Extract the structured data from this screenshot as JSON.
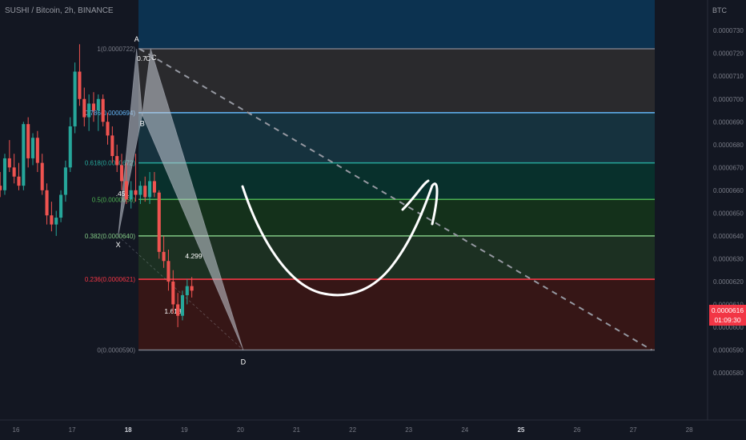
{
  "header": {
    "title": "SUSHI / Bitcoin, 2h, BINANCE",
    "currency": "BTC"
  },
  "price_tag": {
    "price": "0.0000616",
    "countdown": "01:09:30",
    "color": "#f23645"
  },
  "chart_data": {
    "type": "candlestick",
    "y_unit": "BTC",
    "ylim": [
      5.74e-05,
      7.37e-05
    ],
    "y_ticks": [
      "0.0000730",
      "0.0000720",
      "0.0000710",
      "0.0000700",
      "0.0000690",
      "0.0000680",
      "0.0000670",
      "0.0000660",
      "0.0000650",
      "0.0000640",
      "0.0000630",
      "0.0000620",
      "0.0000610",
      "0.0000600",
      "0.0000590",
      "0.0000580"
    ],
    "x_ticks": [
      "16",
      "17",
      "18",
      "19",
      "20",
      "21",
      "22",
      "23",
      "24",
      "25",
      "26",
      "27",
      "28"
    ],
    "x_tick_emphasis": [
      "18",
      "25"
    ],
    "fib_levels": [
      {
        "ratio": "1",
        "value": 7.22e-05,
        "label": "1(0.0000722)",
        "color": "#787b86",
        "fill": "#0c3250"
      },
      {
        "ratio": "0.786",
        "value": 6.94e-05,
        "label": "0.786(0.0000694)",
        "color": "#64b5f6",
        "fill": "#2a2a2d"
      },
      {
        "ratio": "0.618",
        "value": 6.72e-05,
        "label": "0.618(0.0000672)",
        "color": "#26a69a",
        "fill": "#16323e"
      },
      {
        "ratio": "0.5",
        "value": 6.56e-05,
        "label": "0.5(0.0000656)",
        "color": "#4caf50",
        "fill": "#08302c"
      },
      {
        "ratio": "0.382",
        "value": 6.4e-05,
        "label": "0.382(0.0000640)",
        "color": "#81c784",
        "fill": "#14311b"
      },
      {
        "ratio": "0.236",
        "value": 6.21e-05,
        "label": "0.236(0.0000621)",
        "color": "#f23645",
        "fill": "#1c3022"
      },
      {
        "ratio": "0",
        "value": 5.9e-05,
        "label": "0(0.0000590)",
        "color": "#787b86",
        "fill": "#361616"
      }
    ],
    "harmonic_points": [
      {
        "name": "X",
        "day": 17.82,
        "price": 6.4e-05
      },
      {
        "name": "A",
        "day": 18.15,
        "price": 7.22e-05
      },
      {
        "name": "B",
        "day": 18.25,
        "price": 6.93e-05
      },
      {
        "name": "C",
        "day": 18.4,
        "price": 7.22e-05
      },
      {
        "name": "D",
        "day": 20.05,
        "price": 5.9e-05
      }
    ],
    "ratio_labels": [
      "0.7",
      "C",
      ".451",
      "4.299",
      "1.618"
    ],
    "candles": [
      {
        "o": 6.68e-05,
        "h": 6.76e-05,
        "l": 6.58e-05,
        "c": 6.62e-05
      },
      {
        "o": 6.62e-05,
        "h": 6.77e-05,
        "l": 6.57e-05,
        "c": 6.72e-05
      },
      {
        "o": 6.72e-05,
        "h": 6.82e-05,
        "l": 6.64e-05,
        "c": 6.65e-05
      },
      {
        "o": 6.65e-05,
        "h": 6.71e-05,
        "l": 6.57e-05,
        "c": 6.6e-05
      },
      {
        "o": 6.6e-05,
        "h": 6.68e-05,
        "l": 6.54e-05,
        "c": 6.64e-05
      },
      {
        "o": 6.64e-05,
        "h": 6.7e-05,
        "l": 6.56e-05,
        "c": 6.58e-05
      },
      {
        "o": 6.58e-05,
        "h": 6.66e-05,
        "l": 6.52e-05,
        "c": 6.56e-05
      },
      {
        "o": 6.56e-05,
        "h": 6.63e-05,
        "l": 6.54e-05,
        "c": 6.62e-05
      },
      {
        "o": 6.62e-05,
        "h": 6.68e-05,
        "l": 6.57e-05,
        "c": 6.6e-05
      },
      {
        "o": 6.6e-05,
        "h": 6.76e-05,
        "l": 6.58e-05,
        "c": 6.74e-05
      },
      {
        "o": 6.74e-05,
        "h": 6.82e-05,
        "l": 6.68e-05,
        "c": 6.7e-05
      },
      {
        "o": 6.7e-05,
        "h": 6.76e-05,
        "l": 6.63e-05,
        "c": 6.66e-05
      },
      {
        "o": 6.66e-05,
        "h": 6.72e-05,
        "l": 6.6e-05,
        "c": 6.62e-05
      },
      {
        "o": 6.62e-05,
        "h": 6.9e-05,
        "l": 6.6e-05,
        "c": 6.89e-05
      },
      {
        "o": 6.89e-05,
        "h": 6.92e-05,
        "l": 6.7e-05,
        "c": 6.74e-05
      },
      {
        "o": 6.74e-05,
        "h": 6.85e-05,
        "l": 6.71e-05,
        "c": 6.83e-05
      },
      {
        "o": 6.83e-05,
        "h": 6.86e-05,
        "l": 6.68e-05,
        "c": 6.72e-05
      },
      {
        "o": 6.72e-05,
        "h": 6.76e-05,
        "l": 6.58e-05,
        "c": 6.6e-05
      },
      {
        "o": 6.6e-05,
        "h": 6.63e-05,
        "l": 6.45e-05,
        "c": 6.49e-05
      },
      {
        "o": 6.49e-05,
        "h": 6.55e-05,
        "l": 6.42e-05,
        "c": 6.45e-05
      },
      {
        "o": 6.45e-05,
        "h": 6.51e-05,
        "l": 6.4e-05,
        "c": 6.48e-05
      },
      {
        "o": 6.48e-05,
        "h": 6.6e-05,
        "l": 6.46e-05,
        "c": 6.58e-05
      },
      {
        "o": 6.58e-05,
        "h": 6.73e-05,
        "l": 6.55e-05,
        "c": 6.7e-05
      },
      {
        "o": 6.7e-05,
        "h": 6.92e-05,
        "l": 6.68e-05,
        "c": 6.88e-05
      },
      {
        "o": 6.88e-05,
        "h": 7.16e-05,
        "l": 6.85e-05,
        "c": 7.12e-05
      },
      {
        "o": 7.12e-05,
        "h": 7.24e-05,
        "l": 6.97e-05,
        "c": 7e-05
      },
      {
        "o": 7e-05,
        "h": 7.05e-05,
        "l": 6.88e-05,
        "c": 6.92e-05
      },
      {
        "o": 6.92e-05,
        "h": 7.02e-05,
        "l": 6.86e-05,
        "c": 6.98e-05
      },
      {
        "o": 6.98e-05,
        "h": 7.03e-05,
        "l": 6.9e-05,
        "c": 6.95e-05
      },
      {
        "o": 6.95e-05,
        "h": 7.02e-05,
        "l": 6.86e-05,
        "c": 7e-05
      },
      {
        "o": 7e-05,
        "h": 7.02e-05,
        "l": 6.88e-05,
        "c": 6.9e-05
      },
      {
        "o": 6.9e-05,
        "h": 6.94e-05,
        "l": 6.8e-05,
        "c": 6.84e-05
      },
      {
        "o": 6.84e-05,
        "h": 6.88e-05,
        "l": 6.72e-05,
        "c": 6.75e-05
      },
      {
        "o": 6.75e-05,
        "h": 6.8e-05,
        "l": 6.68e-05,
        "c": 6.71e-05
      },
      {
        "o": 6.71e-05,
        "h": 6.76e-05,
        "l": 6.6e-05,
        "c": 6.64e-05
      },
      {
        "o": 6.64e-05,
        "h": 6.72e-05,
        "l": 6.54e-05,
        "c": 6.56e-05
      },
      {
        "o": 6.56e-05,
        "h": 6.64e-05,
        "l": 6.52e-05,
        "c": 6.6e-05
      },
      {
        "o": 6.6e-05,
        "h": 6.76e-05,
        "l": 6.55e-05,
        "c": 6.58e-05
      },
      {
        "o": 6.58e-05,
        "h": 6.64e-05,
        "l": 6.54e-05,
        "c": 6.62e-05
      },
      {
        "o": 6.62e-05,
        "h": 6.66e-05,
        "l": 6.55e-05,
        "c": 6.57e-05
      },
      {
        "o": 6.57e-05,
        "h": 6.68e-05,
        "l": 6.54e-05,
        "c": 6.64e-05
      },
      {
        "o": 6.64e-05,
        "h": 6.68e-05,
        "l": 6.57e-05,
        "c": 6.59e-05
      },
      {
        "o": 6.59e-05,
        "h": 6.6e-05,
        "l": 6.3e-05,
        "c": 6.33e-05
      },
      {
        "o": 6.33e-05,
        "h": 6.4e-05,
        "l": 6.26e-05,
        "c": 6.29e-05
      },
      {
        "o": 6.29e-05,
        "h": 6.34e-05,
        "l": 6.16e-05,
        "c": 6.2e-05
      },
      {
        "o": 6.2e-05,
        "h": 6.25e-05,
        "l": 6.06e-05,
        "c": 6.1e-05
      },
      {
        "o": 6.1e-05,
        "h": 6.15e-05,
        "l": 6e-05,
        "c": 6.05e-05
      },
      {
        "o": 6.05e-05,
        "h": 6.16e-05,
        "l": 6.03e-05,
        "c": 6.14e-05
      },
      {
        "o": 6.14e-05,
        "h": 6.21e-05,
        "l": 6.1e-05,
        "c": 6.18e-05
      },
      {
        "o": 6.18e-05,
        "h": 6.22e-05,
        "l": 6.13e-05,
        "c": 6.16e-05
      }
    ],
    "candle_start_day": 15.05,
    "candles_per_day": 12
  }
}
